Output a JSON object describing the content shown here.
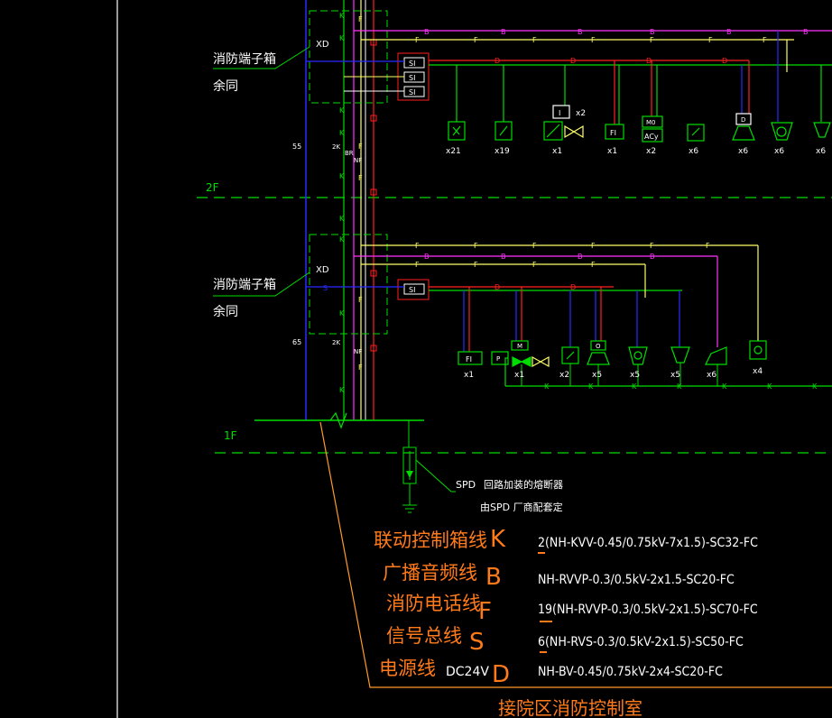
{
  "colors": {
    "background": "#000000",
    "green": "#00dd00",
    "blue": "#2b2bff",
    "red": "#ff2020",
    "magenta": "#ff33ff",
    "yellow": "#ffff66",
    "white": "#ffffff",
    "orange": "#ff7a1a"
  },
  "floors": {
    "second": "2F",
    "first": "1F"
  },
  "terminal_box": {
    "label": "消防端子箱",
    "note": "余同",
    "code": "XD"
  },
  "module_label": "SI",
  "line_letters": {
    "k": "K",
    "b": "B",
    "f": "F",
    "d": "D",
    "s": "S"
  },
  "riser_labels": {
    "upper": "55",
    "lower": "65",
    "zk": "2K",
    "br": "BR",
    "nf": "NF"
  },
  "misc_labels": {
    "fi": "FI",
    "m0": "M0",
    "acy": "ACy",
    "p": "P",
    "m": "M",
    "i": "I",
    "d": "D",
    "o": "O",
    "x2": "x2"
  },
  "devices_2f": {
    "counts": [
      "x21",
      "x19",
      "x1",
      "x1",
      "x2",
      "x6",
      "x6",
      "x6",
      "x6"
    ]
  },
  "devices_1f": {
    "counts": [
      "x1",
      "x1",
      "x2",
      "x5",
      "x5",
      "x5",
      "x6",
      "x4"
    ]
  },
  "spd": {
    "label": "SPD",
    "note1": "回路加装的熔断器",
    "note2": "由SPD 厂商配套定"
  },
  "legend": [
    {
      "name": "联动控制箱线",
      "letter": "K",
      "prefix": "",
      "cable": "2(NH-KVV-0.45/0.75kV-7x1.5)-SC32-FC"
    },
    {
      "name": "广播音频线",
      "letter": "B",
      "prefix": "",
      "cable": "NH-RVVP-0.3/0.5kV-2x1.5-SC20-FC"
    },
    {
      "name": "消防电话线",
      "letter": "F",
      "prefix": "",
      "cable": "19(NH-RVVP-0.3/0.5kV-2x1.5)-SC70-FC"
    },
    {
      "name": "信号总线",
      "letter": "S",
      "prefix": "",
      "cable": "6(NH-RVS-0.3/0.5kV-2x1.5)-SC50-FC"
    },
    {
      "name": "电源线",
      "letter": "D",
      "prefix": "DC24V",
      "cable": "NH-BV-0.45/0.75kV-2x4-SC20-FC"
    }
  ],
  "footer": "接院区消防控制室"
}
